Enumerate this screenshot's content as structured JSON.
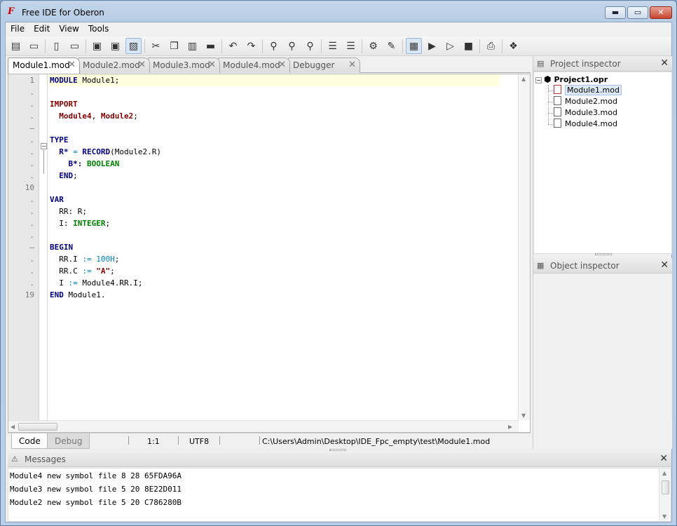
{
  "window": {
    "title": "Free IDE for Oberon",
    "minimize": "▬",
    "maximize": "▭",
    "close": "✕"
  },
  "menu": [
    {
      "label": "File"
    },
    {
      "label": "Edit"
    },
    {
      "label": "View"
    },
    {
      "label": "Tools"
    }
  ],
  "toolbar": [
    {
      "icon": "new-project-icon",
      "glyph": "▤"
    },
    {
      "icon": "open-project-icon",
      "glyph": "▭"
    },
    {
      "sep": true
    },
    {
      "icon": "new-file-icon",
      "glyph": "▯"
    },
    {
      "icon": "open-file-icon",
      "glyph": "▭"
    },
    {
      "sep": true
    },
    {
      "icon": "save-icon",
      "glyph": "▣"
    },
    {
      "icon": "save-all-icon",
      "glyph": "▣"
    },
    {
      "icon": "close-file-icon",
      "glyph": "▨",
      "on": true
    },
    {
      "sep": true
    },
    {
      "icon": "cut-icon",
      "glyph": "✂"
    },
    {
      "icon": "copy-icon",
      "glyph": "❐"
    },
    {
      "icon": "paste-icon",
      "glyph": "▥"
    },
    {
      "icon": "delete-icon",
      "glyph": "▬"
    },
    {
      "sep": true
    },
    {
      "icon": "undo-icon",
      "glyph": "↶"
    },
    {
      "icon": "redo-icon",
      "glyph": "↷"
    },
    {
      "sep": true
    },
    {
      "icon": "find-icon",
      "glyph": "⚲"
    },
    {
      "icon": "find-next-icon",
      "glyph": "⚲"
    },
    {
      "icon": "replace-icon",
      "glyph": "⚲"
    },
    {
      "sep": true
    },
    {
      "icon": "indent-icon",
      "glyph": "☰"
    },
    {
      "icon": "unindent-icon",
      "glyph": "☰"
    },
    {
      "sep": true
    },
    {
      "icon": "settings-icon",
      "glyph": "⚙"
    },
    {
      "icon": "tools-icon",
      "glyph": "✎"
    },
    {
      "sep": true
    },
    {
      "icon": "compile-icon",
      "glyph": "▦",
      "on": true
    },
    {
      "icon": "run-icon",
      "glyph": "▶"
    },
    {
      "icon": "step-icon",
      "glyph": "▷"
    },
    {
      "icon": "stop-icon",
      "glyph": "■"
    },
    {
      "sep": true
    },
    {
      "icon": "print-icon",
      "glyph": "⎙"
    },
    {
      "sep": true
    },
    {
      "icon": "help-icon",
      "glyph": "❖"
    }
  ],
  "tabs": [
    {
      "label": "Module1.mod",
      "active": true
    },
    {
      "label": "Module2.mod"
    },
    {
      "label": "Module3.mod"
    },
    {
      "label": "Module4.mod"
    },
    {
      "label": "Debugger"
    }
  ],
  "tab_close_glyph": "✕",
  "line_numbers": [
    "1",
    ".",
    ".",
    ".",
    "–",
    ".",
    ".",
    ".",
    ".",
    "10",
    ".",
    ".",
    ".",
    ".",
    "–",
    ".",
    ".",
    ".",
    "19"
  ],
  "code_lines": [
    [
      {
        "t": "MODULE",
        "c": "kw"
      },
      {
        "t": " Module1;"
      }
    ],
    [],
    [
      {
        "t": "IMPORT",
        "c": "kw-red"
      }
    ],
    [
      {
        "t": "  "
      },
      {
        "t": "Module4",
        "c": "kw-red"
      },
      {
        "t": ", "
      },
      {
        "t": "Module2",
        "c": "kw-red"
      },
      {
        "t": ";"
      }
    ],
    [],
    [
      {
        "t": "TYPE",
        "c": "kw"
      }
    ],
    [
      {
        "t": "  "
      },
      {
        "t": "R*",
        "c": "kw"
      },
      {
        "t": " = ",
        "c": "op"
      },
      {
        "t": "RECORD",
        "c": "kw"
      },
      {
        "t": "(Module2.R)"
      }
    ],
    [
      {
        "t": "    "
      },
      {
        "t": "B*:",
        "c": "kw"
      },
      {
        "t": " "
      },
      {
        "t": "BOOLEAN",
        "c": "ty"
      }
    ],
    [
      {
        "t": "  "
      },
      {
        "t": "END",
        "c": "kw"
      },
      {
        "t": ";"
      }
    ],
    [],
    [
      {
        "t": "VAR",
        "c": "kw"
      }
    ],
    [
      {
        "t": "  RR: R;"
      }
    ],
    [
      {
        "t": "  I: "
      },
      {
        "t": "INTEGER",
        "c": "ty"
      },
      {
        "t": ";"
      }
    ],
    [],
    [
      {
        "t": "BEGIN",
        "c": "kw"
      }
    ],
    [
      {
        "t": "  RR.I "
      },
      {
        "t": ":=",
        "c": "op"
      },
      {
        "t": " "
      },
      {
        "t": "100H",
        "c": "num"
      },
      {
        "t": ";"
      }
    ],
    [
      {
        "t": "  RR.C "
      },
      {
        "t": ":=",
        "c": "op"
      },
      {
        "t": " "
      },
      {
        "t": "\"A\"",
        "c": "str"
      },
      {
        "t": ";"
      }
    ],
    [
      {
        "t": "  I "
      },
      {
        "t": ":=",
        "c": "op"
      },
      {
        "t": " Module4.RR.I;"
      }
    ],
    [
      {
        "t": "END",
        "c": "kw"
      },
      {
        "t": " Module1."
      }
    ]
  ],
  "status": {
    "code_tab": "Code",
    "debug_tab": "Debug",
    "position": "1:1",
    "encoding": "UTF8",
    "path": "C:\\Users\\Admin\\Desktop\\IDE_Fpc_empty\\test\\Module1.mod"
  },
  "project_inspector": {
    "title": "Project inspector",
    "close": "✕",
    "project": "Project1.opr",
    "files": [
      "Module1.mod",
      "Module2.mod",
      "Module3.mod",
      "Module4.mod"
    ],
    "selected": 0
  },
  "object_inspector": {
    "title": "Object inspector",
    "close": "✕"
  },
  "messages": {
    "title": "Messages",
    "close": "✕",
    "lines": [
      "Module4 new symbol file 8 28 65FDA96A",
      "Module3 new symbol file 5 20 8E22D011",
      "Module2 new symbol file 5 20 C786280B"
    ]
  }
}
